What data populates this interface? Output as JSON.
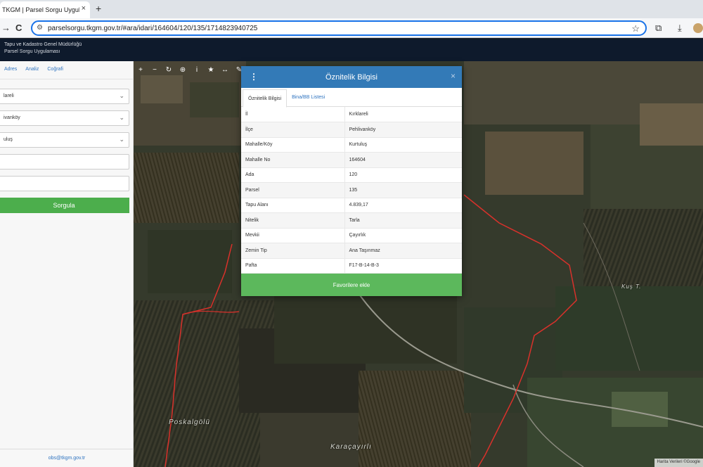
{
  "browser": {
    "tab_title": "TKGM | Parsel Sorgu Uygulam",
    "tab_close": "×",
    "new_tab": "+",
    "url": "parselsorgu.tkgm.gov.tr/#ara/idari/164604/120/135/1714823940725",
    "back_icon": "→",
    "reload_icon": "C"
  },
  "app_header": {
    "line1": "Tapu ve Kadastro Genel Müdürlüğü",
    "line2": "Parsel Sorgu Uygulaması"
  },
  "sidebar": {
    "tabs": [
      "Adres",
      "Analiz",
      "Coğrafi"
    ],
    "selects": [
      "lareli",
      "ivanköy",
      "uluş"
    ],
    "query_button": "Sorgula",
    "footer_email": "obs@tkgm.gov.tr"
  },
  "map": {
    "labels": {
      "poskalgolu": "Poskalgölü",
      "karacayirli": "Karaçayırlı",
      "kus": "Kuş T."
    },
    "attribution": "Harita Verileri ©Google"
  },
  "modal": {
    "title": "Öznitelik Bilgisi",
    "menu_icon": "⋮",
    "close_icon": "×",
    "tabs": [
      "Öznitelik Bilgisi",
      "Bina/BB Listesi"
    ],
    "rows": [
      {
        "key": "İl",
        "value": "Kırklareli"
      },
      {
        "key": "İlçe",
        "value": "Pehlivanköy"
      },
      {
        "key": "Mahalle/Köy",
        "value": "Kurtuluş"
      },
      {
        "key": "Mahalle No",
        "value": "164604"
      },
      {
        "key": "Ada",
        "value": "120"
      },
      {
        "key": "Parsel",
        "value": "135"
      },
      {
        "key": "Tapu Alanı",
        "value": "4.839,17"
      },
      {
        "key": "Nitelik",
        "value": "Tarla"
      },
      {
        "key": "Mevkii",
        "value": "Çayırlık"
      },
      {
        "key": "Zemin Tip",
        "value": "Ana Taşınmaz"
      },
      {
        "key": "Pafta",
        "value": "F17-B-14-B-3"
      }
    ],
    "favorite_button": "Favorilere ekle"
  },
  "colors": {
    "modal_header": "#337ab7",
    "favorite_button": "#5cb85c",
    "query_button": "#4cae4c",
    "parcel_border": "#d9312b"
  }
}
